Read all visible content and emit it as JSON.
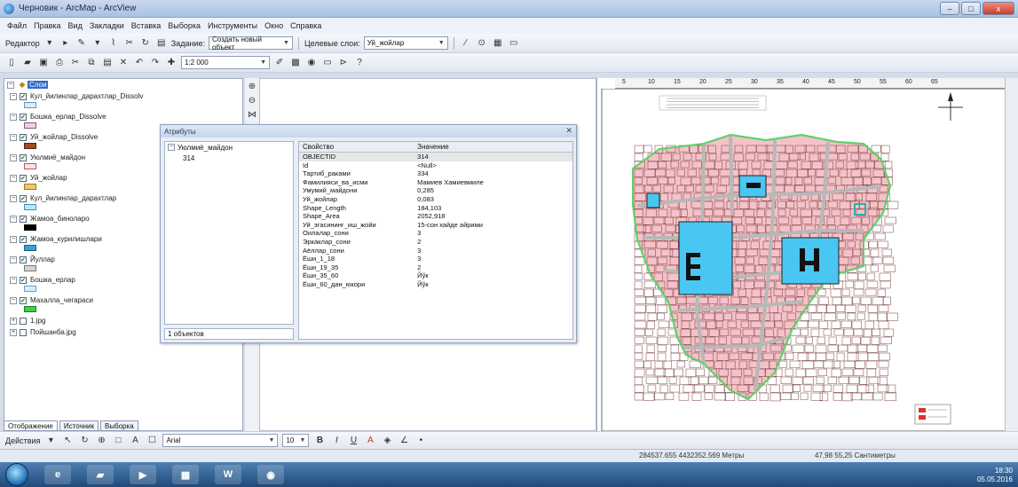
{
  "window": {
    "title": "Черновик - ArcMap - ArcView",
    "minimize": "–",
    "maximize": "□",
    "close": "x"
  },
  "menu": [
    "Файл",
    "Правка",
    "Вид",
    "Закладки",
    "Вставка",
    "Выборка",
    "Инструменты",
    "Окно",
    "Справка"
  ],
  "editor_toolbar": {
    "editor_label": "Редактор",
    "task_label": "Задание:",
    "task_value": "Создать новый объект",
    "target_label": "Целевые слои:",
    "target_value": "Уй_жойлар"
  },
  "standard_toolbar": {
    "scale_value": "1:2 000"
  },
  "toc": {
    "root": "Слои",
    "layers": [
      {
        "name": "Кул_йилинлар_дарахтлар_Dissolv",
        "checked": true,
        "swatch": "#d7ecff",
        "swatch_border": "#6d8fb8"
      },
      {
        "name": "Бошка_ерлар_Dissolve",
        "checked": true,
        "swatch": "#f0d2e8",
        "swatch_border": "#8b5b7a"
      },
      {
        "name": "Уй_жойлар_Dissolve",
        "checked": true,
        "swatch": "#a44a2a",
        "swatch_border": "#5a220f"
      },
      {
        "name": "Уюлмиё_майдон",
        "checked": true,
        "swatch": "#fde5e5",
        "swatch_border": "#b06060"
      },
      {
        "name": "Уй_жойлар",
        "checked": true,
        "swatch": "#f0c86a",
        "swatch_border": "#9b7a20"
      },
      {
        "name": "Кул_йилинлар_дарахтлар",
        "checked": true,
        "swatch": "#b8e8ff",
        "swatch_border": "#4a8db8"
      },
      {
        "name": "Жамоа_биноларо",
        "checked": true,
        "swatch": "#000000",
        "swatch_border": "#000000"
      },
      {
        "name": "Жамоа_курилишлари",
        "checked": true,
        "swatch": "#3aa1d8",
        "swatch_border": "#205f85"
      },
      {
        "name": "Йуллар",
        "checked": true,
        "swatch": "#d4d4d4",
        "swatch_border": "#7a7a7a"
      },
      {
        "name": "Бошка_ерлар",
        "checked": true,
        "swatch": "#d6eefc",
        "swatch_border": "#6a9cc0"
      },
      {
        "name": "Махалла_чегараси",
        "checked": true,
        "swatch": "#3bd14a",
        "swatch_border": "#1c7a24"
      },
      {
        "name": "1.jpg",
        "checked": false,
        "swatch": "",
        "swatch_border": ""
      },
      {
        "name": "Пойшанба.jpg",
        "checked": false,
        "swatch": "",
        "swatch_border": ""
      }
    ],
    "tabs": [
      "Отображение",
      "Источник",
      "Выборка"
    ]
  },
  "attributes": {
    "title": "Атрибуты",
    "tree_parent": "Уюлмиё_майдон",
    "tree_child": "314",
    "count_label": "1 объектов",
    "col_property": "Свойство",
    "col_value": "Значение",
    "rows": [
      {
        "prop": "OBJECTID",
        "val": "314",
        "selected": true
      },
      {
        "prop": "Id",
        "val": "<Null>",
        "selected": false
      },
      {
        "prop": "Тартиб_раками",
        "val": "334",
        "selected": false
      },
      {
        "prop": "Фамилияси_ва_исми",
        "val": "Мамиев Хамиевмиле",
        "selected": false
      },
      {
        "prop": "Умумий_майдони",
        "val": "0,285",
        "selected": false
      },
      {
        "prop": "Уй_жойлар",
        "val": "0,083",
        "selected": false
      },
      {
        "prop": "Shape_Length",
        "val": "184,103",
        "selected": false
      },
      {
        "prop": "Shape_Area",
        "val": "2052,918",
        "selected": false
      },
      {
        "prop": "Уй_эгасининг_иш_жойи",
        "val": "15-сон хайде айрими",
        "selected": false
      },
      {
        "prop": "Оилалар_сони",
        "val": "3",
        "selected": false
      },
      {
        "prop": "Эркаклар_сони",
        "val": "2",
        "selected": false
      },
      {
        "prop": "Аёллар_сони",
        "val": "3",
        "selected": false
      },
      {
        "prop": "Ёши_1_18",
        "val": "3",
        "selected": false
      },
      {
        "prop": "Ёши_19_35",
        "val": "2",
        "selected": false
      },
      {
        "prop": "Ёши_35_60",
        "val": "Йўк",
        "selected": false
      },
      {
        "prop": "Ёши_60_дан_юкори",
        "val": "Йўк",
        "selected": false
      }
    ]
  },
  "ruler_ticks": [
    "5",
    "10",
    "15",
    "20",
    "25",
    "30",
    "35",
    "40",
    "45",
    "50",
    "55",
    "60",
    "65"
  ],
  "drawing_toolbar": {
    "actions_label": "Действия",
    "font_value": "Arial",
    "size_value": "10"
  },
  "status": {
    "coords": "284537.655  4432352.569 Метры",
    "page_coords": "47,98  55,25 Сантиметры"
  },
  "taskbar": {
    "time": "18:30",
    "date": "05.05.2016"
  },
  "map_colors": {
    "parcel_fill": "#f4c2c8",
    "parcel_stroke": "#6b2a2a",
    "road": "#b8b8b8",
    "blue": "#49c6f2",
    "boundary": "#5fd16a"
  }
}
